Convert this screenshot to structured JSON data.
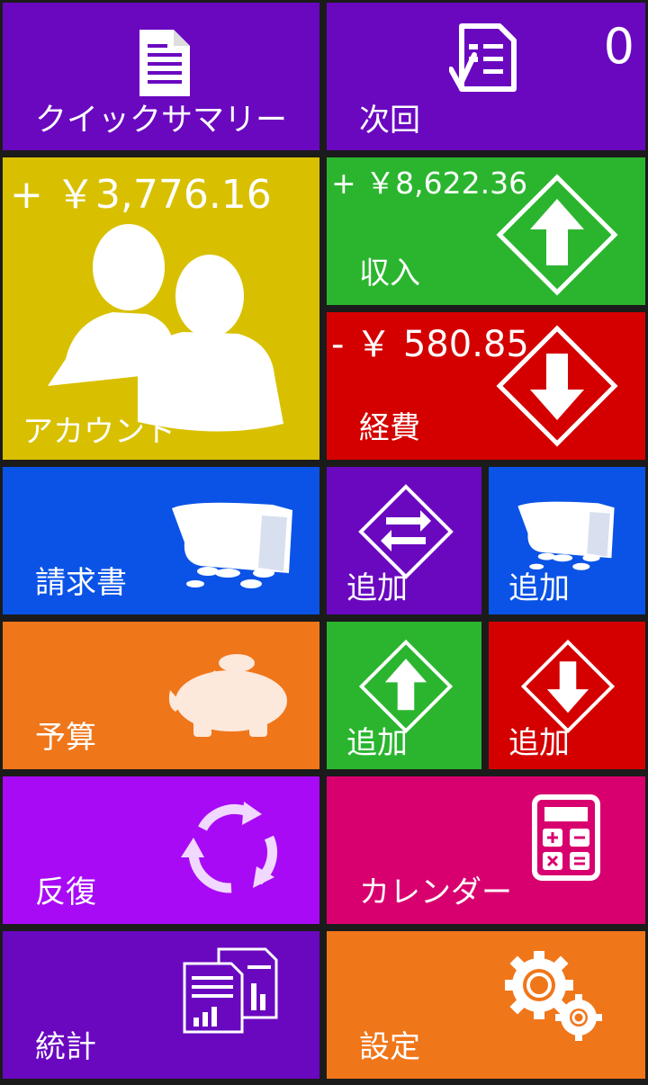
{
  "colors": {
    "purple": "#6a08c0",
    "yellow": "#d8c000",
    "green": "#2bb52f",
    "red": "#d40000",
    "blue": "#0a53e6",
    "orange": "#f0761a",
    "violet": "#a80af5",
    "magenta": "#d8006e"
  },
  "tiles": {
    "quick_summary": {
      "label": "クイックサマリー",
      "icon": "document-icon"
    },
    "next": {
      "label": "次回",
      "count": "0",
      "icon": "checklist-icon"
    },
    "accounts": {
      "label": "アカウント",
      "amount": "+ ￥3,776.16",
      "icon": "people-icon"
    },
    "income": {
      "label": "収入",
      "amount": "+ ￥8,622.36",
      "icon": "arrow-up-diamond-icon"
    },
    "expenses": {
      "label": "経費",
      "amount": "- ￥ 580.85",
      "icon": "arrow-down-diamond-icon"
    },
    "bills": {
      "label": "請求書",
      "icon": "wallet-coins-icon"
    },
    "add_transfer": {
      "label": "追加",
      "icon": "transfer-diamond-icon"
    },
    "add_bill": {
      "label": "追加",
      "icon": "wallet-coins-icon"
    },
    "budget": {
      "label": "予算",
      "icon": "piggy-bank-icon"
    },
    "add_income": {
      "label": "追加",
      "icon": "arrow-up-diamond-icon"
    },
    "add_expense": {
      "label": "追加",
      "icon": "arrow-down-diamond-icon"
    },
    "recurring": {
      "label": "反復",
      "icon": "cycle-arrows-icon"
    },
    "calendar": {
      "label": "カレンダー",
      "icon": "calculator-icon"
    },
    "statistics": {
      "label": "統計",
      "icon": "report-chart-icon"
    },
    "settings": {
      "label": "設定",
      "icon": "gears-icon"
    }
  }
}
